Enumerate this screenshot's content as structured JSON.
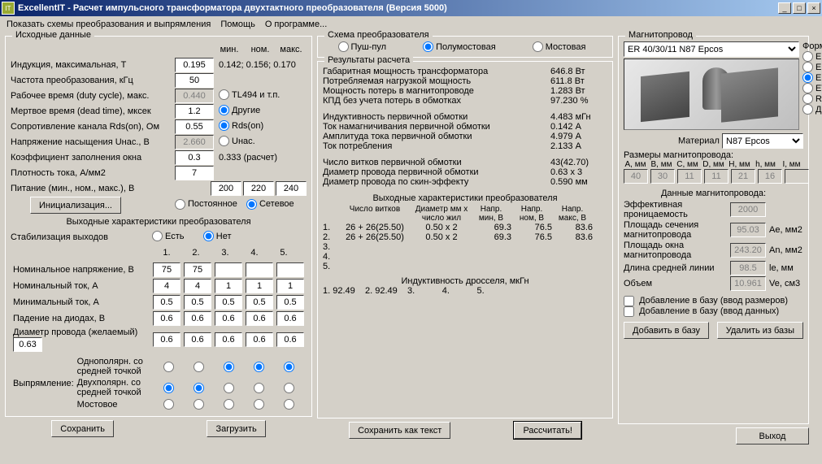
{
  "window": {
    "title": "ExcellentIT - Расчет импульсного трансформатора двухтактного преобразователя (Версия 5000)",
    "min": "_",
    "max": "□",
    "close": "×"
  },
  "menu": {
    "schemes": "Показать схемы преобразования и выпрямления",
    "help": "Помощь",
    "about": "О программе..."
  },
  "left": {
    "group_title": "Исходные данные",
    "cols": {
      "min": "мин.",
      "nom": "ном.",
      "max": "макс."
    },
    "induction_lbl": "Индукция, максимальная, Т",
    "induction_val": "0.195",
    "induction_vals": "0.142; 0.156; 0.170",
    "freq_lbl": "Частота преобразования, кГц",
    "freq_val": "50",
    "duty_lbl": "Рабочее время (duty cycle), макс.",
    "duty_val": "0.440",
    "tl494": "TL494 и т.п.",
    "dead_lbl": "Мертвое время (dead time), мксек",
    "dead_val": "1.2",
    "other": "Другие",
    "rds_lbl": "Сопротивление канала Rds(on), Ом",
    "rds_val": "0.55",
    "rds_radio": "Rds(on)",
    "unasl": "Напряжение насыщения Uнас., В",
    "unas_val": "2.660",
    "unas_radio": "Uнас.",
    "kfill_lbl": "Коэффициент заполнения окна",
    "kfill_val": "0.3",
    "kfill_calc": "0.333 (расчет)",
    "jden_lbl": "Плотность тока, А/мм2",
    "jden_val": "7",
    "supply_lbl": "Питание (мин., ном., макс.), В",
    "supply": {
      "min": "200",
      "nom": "220",
      "max": "240"
    },
    "init_btn": "Инициализация...",
    "supply_type": {
      "const": "Постоянное",
      "ac": "Сетевое"
    },
    "outchar_title": "Выходные характеристики преобразователя",
    "stab_lbl": "Стабилизация выходов",
    "stab_yes": "Есть",
    "stab_no": "Нет",
    "out_cols": [
      "1.",
      "2.",
      "3.",
      "4.",
      "5."
    ],
    "vnom_lbl": "Номинальное напряжение, В",
    "vnom": [
      "75",
      "75",
      "",
      "",
      ""
    ],
    "inom_lbl": "Номинальный ток, А",
    "inom": [
      "4",
      "4",
      "1",
      "1",
      "1"
    ],
    "imin_lbl": "Минимальный ток, А",
    "imin": [
      "0.5",
      "0.5",
      "0.5",
      "0.5",
      "0.5"
    ],
    "vdrop_lbl": "Падение на диодах, В",
    "vdrop": [
      "0.6",
      "0.6",
      "0.6",
      "0.6",
      "0.6"
    ],
    "dwire_lbl": "Диаметр провода (желаемый)",
    "dwire_val": "0.63",
    "dwire_row": [
      "0.6",
      "0.6",
      "0.6",
      "0.6",
      "0.6"
    ],
    "rect_lbl": "Выпрямление:",
    "rect1": "Однополярн. со средней точкой",
    "rect2": "Двухполярн. со средней точкой",
    "rect3": "Мостовое",
    "save_btn": "Сохранить",
    "load_btn": "Загрузить"
  },
  "mid": {
    "scheme_title": "Схема преобразователя",
    "scheme": {
      "pp": "Пуш-пул",
      "hb": "Полумостовая",
      "fb": "Мостовая"
    },
    "results_title": "Результаты расчета",
    "r1_l": "Габаритная мощность трансформатора",
    "r1_v": "646.8 Вт",
    "r2_l": "Потребляемая нагрузкой мощность",
    "r2_v": "611.8 Вт",
    "r3_l": "Мощность потерь в магнитопроводе",
    "r3_v": "1.283 Вт",
    "r4_l": "КПД без учета потерь в обмотках",
    "r4_v": "97.230 %",
    "r5_l": "Индуктивность первичной обмотки",
    "r5_v": "4.483 мГн",
    "r6_l": "Ток намагничивания первичной обмотки",
    "r6_v": "0.142 А",
    "r7_l": "Амплитуда тока первичной обмотки",
    "r7_v": "4.979 А",
    "r8_l": "Ток потребления",
    "r8_v": "2.133 А",
    "r9_l": "Число витков первичной обмотки",
    "r9_v": "43(42.70)",
    "r10_l": "Диаметр провода первичной обмотки",
    "r10_v": "0.63 x 3",
    "r11_l": "Диаметр провода по скин-эффекту",
    "r11_v": "0.590 мм",
    "out_title": "Выходные характеристики преобразователя",
    "out_hdr": {
      "n": "Число витков",
      "d": "Диаметр мм x число жил",
      "vmin": "Напр. мин, В",
      "vnom": "Напр. ном, В",
      "vmax": "Напр. макс, В"
    },
    "out_rows": [
      {
        "i": "1.",
        "n": "26 + 26(25.50)",
        "d": "0.50 x 2",
        "vmin": "69.3",
        "vnom": "76.5",
        "vmax": "83.6"
      },
      {
        "i": "2.",
        "n": "26 + 26(25.50)",
        "d": "0.50 x 2",
        "vmin": "69.3",
        "vnom": "76.5",
        "vmax": "83.6"
      },
      {
        "i": "3.",
        "n": "",
        "d": "",
        "vmin": "",
        "vnom": "",
        "vmax": ""
      },
      {
        "i": "4.",
        "n": "",
        "d": "",
        "vmin": "",
        "vnom": "",
        "vmax": ""
      },
      {
        "i": "5.",
        "n": "",
        "d": "",
        "vmin": "",
        "vnom": "",
        "vmax": ""
      }
    ],
    "ind_title": "Индуктивность дросселя, мкГн",
    "ind_row": "1. 92.49    2. 92.49    3.           4.           5.",
    "save_txt_btn": "Сохранить как текст",
    "calc_btn": "Рассчитать!"
  },
  "right": {
    "core_title": "Магнитопровод",
    "core_select": "ER 40/30/11 N87 Epcos",
    "form_lbl": "Форма",
    "forms": [
      "E",
      "EI",
      "ER",
      "ETD",
      "R",
      "Другая"
    ],
    "form_sel": 2,
    "material_lbl": "Материал",
    "material_sel": "N87 Epcos",
    "dims_title": "Размеры магнитопровода:",
    "dim_hdr": [
      "A, мм",
      "B, мм",
      "C, мм",
      "D, мм",
      "H, мм",
      "h, мм",
      "I, мм"
    ],
    "dim_val": [
      "40",
      "30",
      "11",
      "11",
      "21",
      "16",
      ""
    ],
    "data_title": "Данные магнитопровода:",
    "perm_lbl": "Эффективная проницаемость",
    "perm_val": "2000",
    "ae_lbl": "Площадь сечения магнитопровода",
    "ae_val": "95.03",
    "ae_u": "Ae, мм2",
    "an_lbl": "Площадь окна магнитопровода",
    "an_val": "243.20",
    "an_u": "An, мм2",
    "le_lbl": "Длина средней линии",
    "le_val": "98.5",
    "le_u": "le, мм",
    "ve_lbl": "Объем",
    "ve_val": "10.961",
    "ve_u": "Ve, см3",
    "add_dims": "Добавление в базу (ввод размеров)",
    "add_data": "Добавление в базу (ввод данных)",
    "add_btn": "Добавить в базу",
    "del_btn": "Удалить из базы",
    "exit_btn": "Выход"
  }
}
